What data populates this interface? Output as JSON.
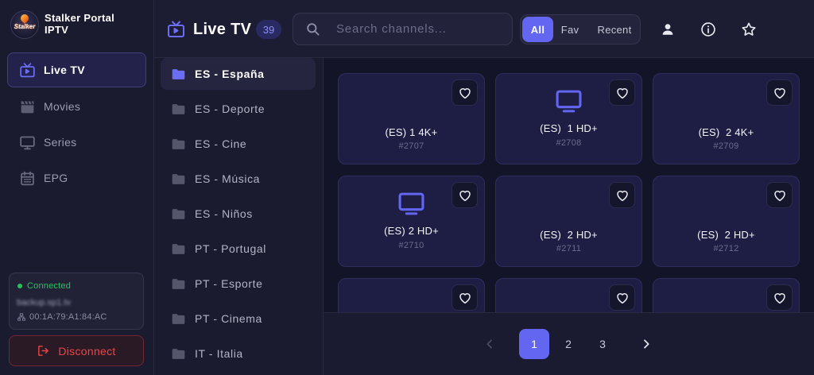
{
  "app": {
    "logo_text": "Stalker",
    "title_line1": "Stalker Portal",
    "title_line2": "IPTV"
  },
  "sidebar": {
    "items": [
      {
        "label": "Live TV",
        "icon": "tv-icon",
        "active": true
      },
      {
        "label": "Movies",
        "icon": "clapperboard-icon",
        "active": false
      },
      {
        "label": "Series",
        "icon": "monitor-icon",
        "active": false
      },
      {
        "label": "EPG",
        "icon": "calendar-icon",
        "active": false
      }
    ]
  },
  "connection": {
    "status": "Connected",
    "server": "backup.sp1.tv",
    "mac_address": "00:1A:79:A1:84:AC",
    "mac_icon": "network-icon"
  },
  "disconnect": {
    "label": "Disconnect",
    "icon": "logout-icon"
  },
  "header": {
    "title": "Live TV",
    "title_icon": "tv-icon",
    "channel_count": "39",
    "search_placeholder": "Search channels...",
    "search_icon": "search-icon",
    "filters": [
      {
        "label": "All",
        "active": true
      },
      {
        "label": "Fav",
        "active": false
      },
      {
        "label": "Recent",
        "active": false
      }
    ],
    "actions": [
      "user-icon",
      "info-icon",
      "star-icon"
    ]
  },
  "categories": [
    {
      "label": "ES - España",
      "active": true
    },
    {
      "label": "ES - Deporte",
      "active": false
    },
    {
      "label": "ES - Cine",
      "active": false
    },
    {
      "label": "ES - Música",
      "active": false
    },
    {
      "label": "ES - Niños",
      "active": false
    },
    {
      "label": "PT - Portugal",
      "active": false
    },
    {
      "label": "PT - Esporte",
      "active": false
    },
    {
      "label": "PT - Cinema",
      "active": false
    },
    {
      "label": "IT - Italia",
      "active": false
    }
  ],
  "channels": [
    {
      "name": "(ES) 1 4K+",
      "number": "#2707"
    },
    {
      "name": "(ES)  1 HD+",
      "number": "#2708",
      "icon": "tv-icon"
    },
    {
      "name": "(ES)  2 4K+",
      "number": "#2709"
    },
    {
      "name": "(ES) 2 HD+",
      "number": "#2710",
      "icon": "tv-icon"
    },
    {
      "name": "(ES)  2 HD+",
      "number": "#2711"
    },
    {
      "name": "(ES)  2 HD+",
      "number": "#2712"
    }
  ],
  "pagination": {
    "pages": [
      {
        "label": "1",
        "active": true
      },
      {
        "label": "2",
        "active": false
      },
      {
        "label": "3",
        "active": false
      }
    ],
    "prev_enabled": false,
    "next_enabled": true
  },
  "theme": {
    "accent": "#6366f1",
    "connected": "#22c55e",
    "danger": "#ef4444",
    "card_bg": "#1e1e45"
  }
}
